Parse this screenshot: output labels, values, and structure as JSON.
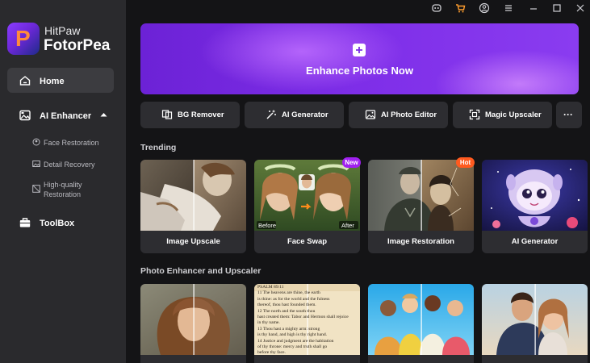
{
  "app": {
    "brand_line1": "HitPaw",
    "brand_line2": "FotorPea",
    "logo_letter": "P"
  },
  "titlebar": {
    "icons": [
      "discord-icon",
      "cart-icon",
      "account-icon",
      "menu-icon",
      "minimize-icon",
      "maximize-icon",
      "close-icon"
    ]
  },
  "sidebar": {
    "home": "Home",
    "ai_enhancer": "AI Enhancer",
    "sub_items": [
      {
        "label": "Face Restoration"
      },
      {
        "label": "Detail Recovery"
      },
      {
        "label_line1": "High-quality",
        "label_line2": "Restoration"
      }
    ],
    "toolbox": "ToolBox"
  },
  "hero": {
    "label": "Enhance Photos Now"
  },
  "tools": [
    {
      "label": "BG Remover"
    },
    {
      "label": "AI Generator"
    },
    {
      "label": "AI Photo Editor"
    },
    {
      "label": "Magic Upscaler"
    }
  ],
  "more_label": "···",
  "trending": {
    "title": "Trending",
    "cards": [
      {
        "caption": "Image Upscale"
      },
      {
        "caption": "Face Swap",
        "badge": "New",
        "before": "Before",
        "after": "After"
      },
      {
        "caption": "Image Restoration",
        "badge": "Hot"
      },
      {
        "caption": "AI Generator"
      }
    ]
  },
  "enhancer_section": {
    "title": "Photo Enhancer and Upscaler",
    "book_text": [
      "PSALM 89:11",
      "11 The heavens are thine, the earth",
      "is thine: as for the world and the fulness",
      "thereof, thou hast founded them.",
      "12 The north and the south thou",
      "hast created them: Tabor and Hermon shall rejoice",
      "in thy name.",
      "13 Thou hast a mighty arm: strong",
      "is thy hand, and high is thy right hand.",
      "14 Justice and judgment are the habitation",
      "of thy throne: mercy and truth shall go",
      "before thy face."
    ]
  },
  "colors": {
    "accent": "#8a3cf0",
    "badge_new": "#a020f0",
    "badge_hot": "#ff5a1f",
    "sidebar": "#2a2a2d",
    "background": "#141416"
  }
}
